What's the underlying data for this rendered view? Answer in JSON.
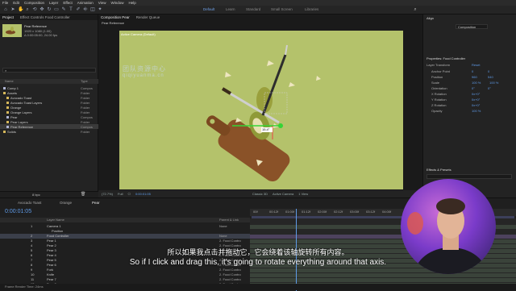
{
  "menu": [
    "File",
    "Edit",
    "Composition",
    "Layer",
    "Effect",
    "Animation",
    "View",
    "Window",
    "Help"
  ],
  "workspaces": [
    "Default",
    "Learn",
    "Standard",
    "Small Screen",
    "Libraries"
  ],
  "project": {
    "tabs": [
      "Project",
      "Effect Controls Food Controller"
    ],
    "item_name": "Pear Reference",
    "item_info1": "1920 x 1080 (1.00)",
    "item_info2": "Δ 0:00:05:00, 24.00 fps",
    "col_name": "Name",
    "col_type": "Type",
    "rows": [
      {
        "name": "Comp 1",
        "type": "Compos"
      },
      {
        "name": "Assets",
        "type": "Folder"
      },
      {
        "name": "Avocado Toast",
        "type": "Folder"
      },
      {
        "name": "Avocado Toast Layers",
        "type": "Folder"
      },
      {
        "name": "Orange",
        "type": "Folder"
      },
      {
        "name": "Orange Layers",
        "type": "Folder"
      },
      {
        "name": "Pear",
        "type": "Compos"
      },
      {
        "name": "Pear Layers",
        "type": "Folder"
      },
      {
        "name": "Pear Reference",
        "type": "Compos"
      },
      {
        "name": "Solids",
        "type": "Folder"
      }
    ],
    "bpc": "8 bpc"
  },
  "comp": {
    "tabs": [
      "Composition Pear",
      "Render Queue"
    ],
    "subtab": "Pear Reference",
    "camera_label": "Active Camera (Default)",
    "zoom": "(72.7%)",
    "resolution": "Full",
    "renderer": "Classic 3D",
    "camera": "Active Camera",
    "view": "1 View",
    "timecode": "0:00:01:05",
    "handle_label": "15.4°",
    "watermark1": "团队资源中心",
    "watermark2": "qiqiyuanma.cn"
  },
  "right_panel": {
    "align_title": "Align",
    "align_to": "Composition",
    "props_title": "Properties: Food Controller",
    "layer_transform": "Layer Transform",
    "reset": "Reset",
    "props": [
      {
        "label": "Anchor Point",
        "v1": "0",
        "v2": "0"
      },
      {
        "label": "Position",
        "v1": "960",
        "v2": "540"
      },
      {
        "label": "Scale",
        "v1": "100 %",
        "v2": "100 %"
      },
      {
        "label": "Orientation",
        "v1": "0°",
        "v2": "0°"
      },
      {
        "label": "X Rotation",
        "v1": "0x+0°",
        "v2": ""
      },
      {
        "label": "Y Rotation",
        "v1": "0x+0°",
        "v2": ""
      },
      {
        "label": "Z Rotation",
        "v1": "0x+0°",
        "v2": ""
      },
      {
        "label": "Opacity",
        "v1": "100 %",
        "v2": ""
      }
    ],
    "effects_title": "Effects & Presets"
  },
  "timeline": {
    "tabs": [
      "Avocado Toast",
      "Orange",
      "Pear"
    ],
    "timecode": "0:00:01:05",
    "ruler": [
      "00f",
      "00:12f",
      "01:00f",
      "01:12f",
      "02:00f",
      "02:12f",
      "03:00f",
      "03:12f",
      "04:00f"
    ],
    "col_layer": "Layer Name",
    "col_parent": "Parent & Link",
    "layers": [
      {
        "num": "1",
        "name": "Camera 1",
        "parent": "None"
      },
      {
        "num": "",
        "name": "Position",
        "parent": ""
      },
      {
        "num": "2",
        "name": "Food Controller",
        "parent": "None"
      },
      {
        "num": "3",
        "name": "Pear 1",
        "parent": "2. Food Contro"
      },
      {
        "num": "4",
        "name": "Pear 2",
        "parent": "2. Food Contro"
      },
      {
        "num": "5",
        "name": "Pear 3",
        "parent": "2. Food Contro"
      },
      {
        "num": "6",
        "name": "Pear 4",
        "parent": "2. Food Contro"
      },
      {
        "num": "7",
        "name": "Pear 5",
        "parent": "2. Food Contro"
      },
      {
        "num": "8",
        "name": "Pear 6",
        "parent": "2. Food Contro"
      },
      {
        "num": "9",
        "name": "Fork",
        "parent": "2. Food Contro"
      },
      {
        "num": "10",
        "name": "Knife",
        "parent": "2. Food Contro"
      },
      {
        "num": "11",
        "name": "Pear 7",
        "parent": "2. Food Contro"
      },
      {
        "num": "12",
        "name": "Pear 8",
        "parent": "2. Food Contro"
      }
    ],
    "render_time": "Frame Render Time: 24ms"
  },
  "subtitles": {
    "cn": "所以如果我点击并拖动它，它会绕着该轴旋转所有内容。",
    "en": "So if I click and drag this, it's going to rotate everything around that axis."
  },
  "colors": {
    "accent": "#5f9be8",
    "comp_bg": "#b4c26b",
    "board": "#8a5228",
    "selected_row": "#3b3f4a"
  }
}
